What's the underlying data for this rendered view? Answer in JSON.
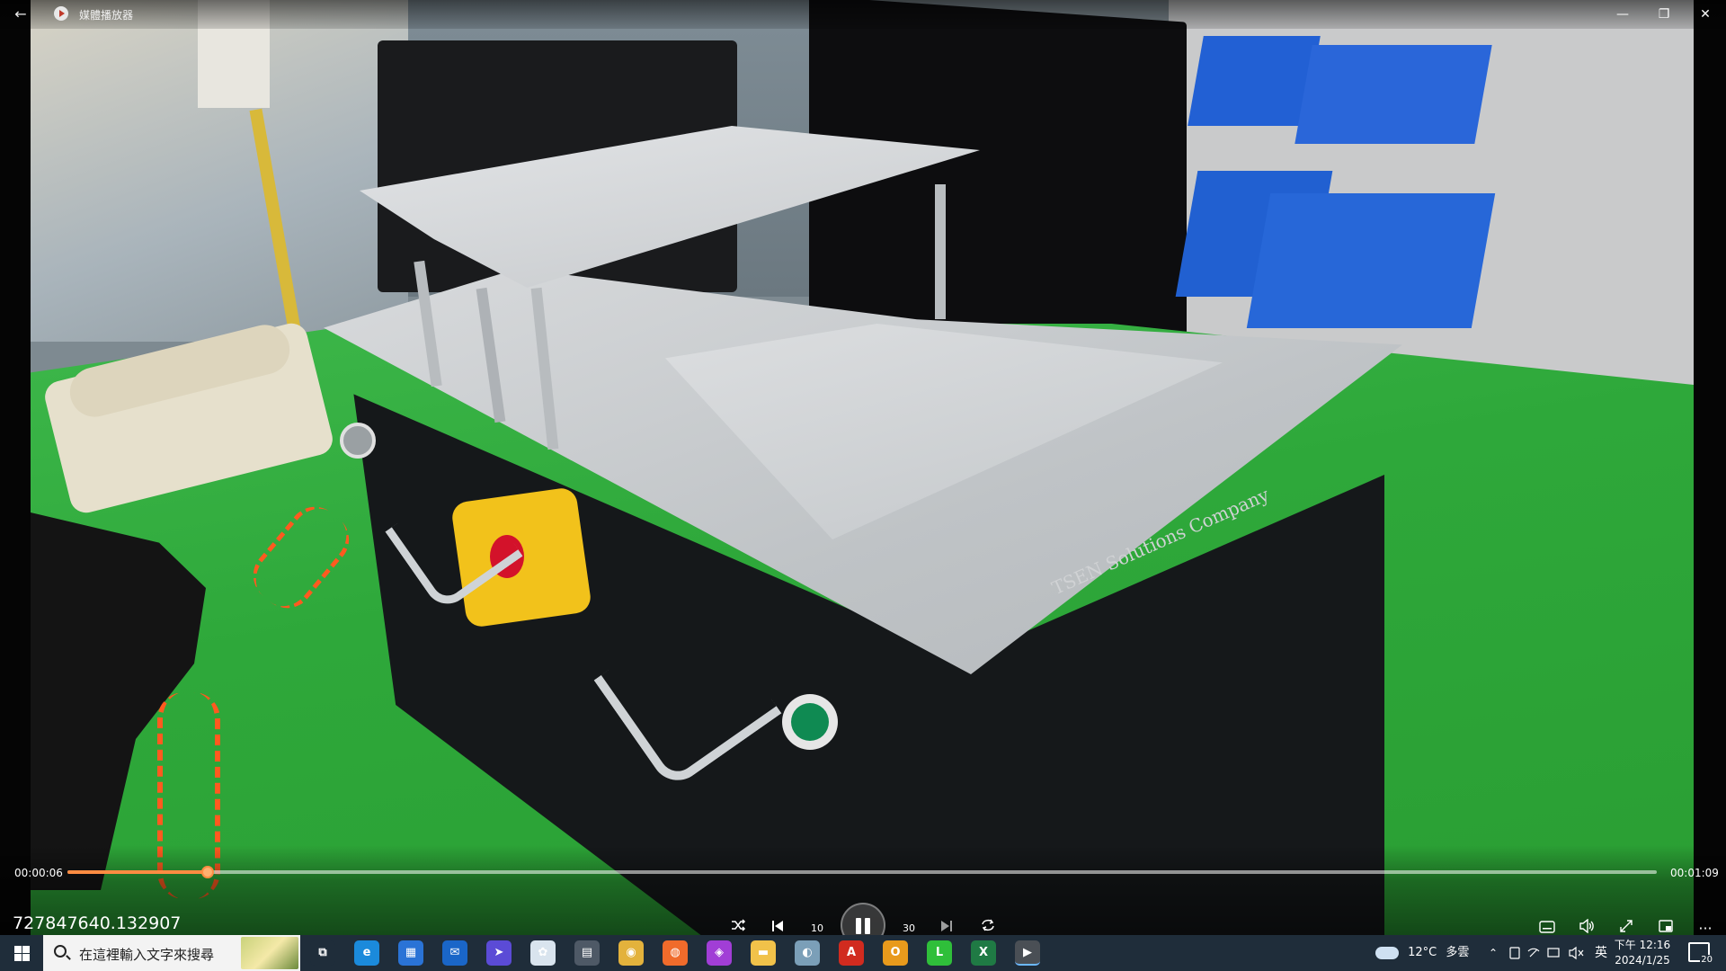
{
  "window": {
    "title": "媒體播放器",
    "back_label": "←",
    "minimize_label": "—",
    "restore_label": "❐",
    "close_label": "✕"
  },
  "video": {
    "machine_label": "TSEN Solutions Company"
  },
  "player": {
    "elapsed": "00:00:06",
    "duration": "00:01:09",
    "progress_fraction": 0.088,
    "overlay_text": "727847640.132907",
    "accent_color": "#ff8c42",
    "controls": {
      "shuffle_icon": "shuffle-icon",
      "previous_icon": "previous-icon",
      "rewind_label": "10",
      "forward_label": "30",
      "next_icon": "next-icon",
      "repeat_icon": "repeat-icon",
      "subtitles_icon": "subtitles-icon",
      "volume_icon": "volume-icon",
      "fullscreen_icon": "fullscreen-icon",
      "miniplayer_icon": "miniplayer-icon",
      "more_label": "···"
    }
  },
  "taskbar": {
    "search_placeholder": "在這裡輸入文字來搜尋",
    "weather_temp": "12°C",
    "weather_desc": "多雲",
    "ime_label": "英",
    "time": "下午 12:16",
    "date": "2024/1/25",
    "notification_count": "20",
    "apps": [
      {
        "name": "task-view-icon",
        "color": "#1f2d3a"
      },
      {
        "name": "edge-icon",
        "color": "#1b8adb"
      },
      {
        "name": "store-icon",
        "color": "#2a73d6"
      },
      {
        "name": "mail-icon",
        "color": "#1a66c8"
      },
      {
        "name": "app-arrow-icon",
        "color": "#5b4bd6"
      },
      {
        "name": "app-bird-icon",
        "color": "#d9e4ee"
      },
      {
        "name": "calculator-icon",
        "color": "#4e5966"
      },
      {
        "name": "chrome-icon",
        "color": "#e3b23c"
      },
      {
        "name": "firefox-icon",
        "color": "#f06b2b"
      },
      {
        "name": "app-purple-icon",
        "color": "#a13ed6"
      },
      {
        "name": "file-explorer-icon",
        "color": "#f1c24a"
      },
      {
        "name": "app-globe-icon",
        "color": "#7b9fb8"
      },
      {
        "name": "acrobat-icon",
        "color": "#d12b1f"
      },
      {
        "name": "outlook-icon",
        "color": "#e89a1c"
      },
      {
        "name": "line-icon",
        "color": "#2fbf3a"
      },
      {
        "name": "excel-icon",
        "color": "#1f7a44"
      },
      {
        "name": "media-player-icon",
        "color": "#3a3a3a"
      }
    ]
  }
}
